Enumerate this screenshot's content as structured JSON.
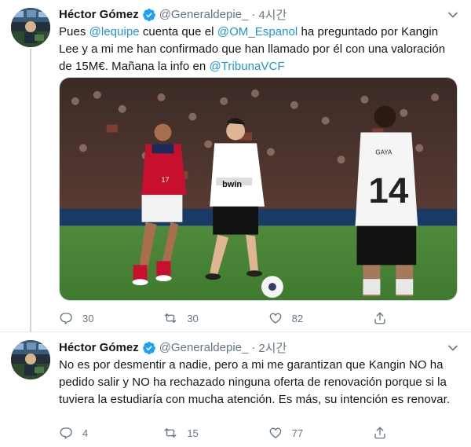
{
  "tweets": [
    {
      "author_name": "Héctor Gómez",
      "handle": "@Generaldepie_",
      "separator": "·",
      "time": "4시간",
      "text_parts": [
        {
          "t": "Pues ",
          "link": false
        },
        {
          "t": "@lequipe",
          "link": true
        },
        {
          "t": " cuenta que el ",
          "link": false
        },
        {
          "t": "@OM_Espanol",
          "link": true
        },
        {
          "t": " ha preguntado por Kangin Lee y a mi me han confirmado que han llamado por él con una valoración de 15M€. Mañana la info en ",
          "link": false
        },
        {
          "t": "@TribunaVCF",
          "link": true
        }
      ],
      "media": {
        "sponsor": "bwin",
        "player_front_number": "17",
        "player_back_name": "GAYA",
        "player_back_number": "14"
      },
      "replies": "30",
      "retweets": "30",
      "likes": "82"
    },
    {
      "author_name": "Héctor Gómez",
      "handle": "@Generaldepie_",
      "separator": "·",
      "time": "2시간",
      "text_parts": [
        {
          "t": "No es por desmentir a nadie, pero a mi me garantizan que Kangin NO ha pedido salir y NO ha rechazado ninguna oferta de renovación porque si la tuviera la estudiaría con mucha atención. Es más, su intención es renovar.",
          "link": false
        }
      ],
      "replies": "4",
      "retweets": "15",
      "likes": "77"
    }
  ],
  "icons": {
    "verified": "verified-badge-icon",
    "reply": "reply-icon",
    "retweet": "retweet-icon",
    "like": "heart-icon",
    "share": "share-icon",
    "more": "chevron-down-icon"
  },
  "colors": {
    "link": "#1b95e0",
    "secondary_text": "#657786",
    "verified": "#1da1f2"
  }
}
